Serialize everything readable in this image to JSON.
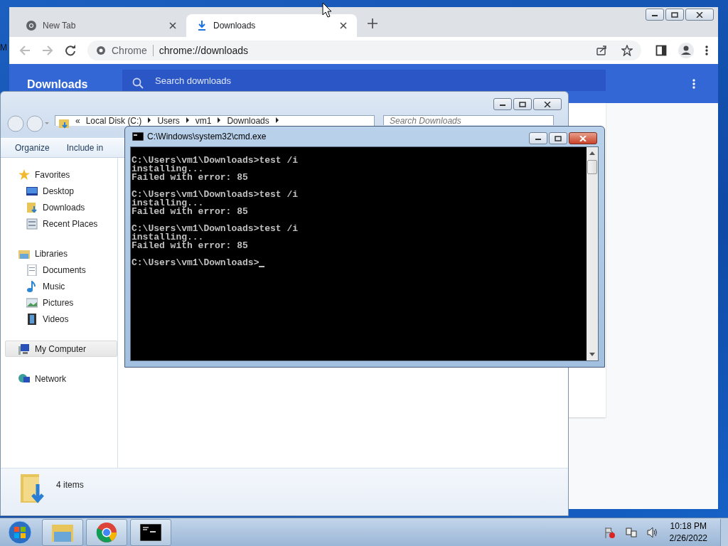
{
  "desktop": {
    "icon_label": "M"
  },
  "chrome": {
    "tabs": [
      {
        "title": "New Tab",
        "kind": "chrome",
        "selected": false
      },
      {
        "title": "Downloads",
        "kind": "download",
        "selected": true
      }
    ],
    "omnibox": {
      "site": "Chrome",
      "url": "chrome://downloads"
    },
    "page": {
      "title": "Downloads",
      "search_placeholder": "Search downloads"
    }
  },
  "explorer": {
    "overflow": "«",
    "breadcrumb": [
      "Local Disk (C:)",
      "Users",
      "vm1",
      "Downloads"
    ],
    "search_placeholder": "Search Downloads",
    "toolbar": [
      "Organize",
      "Include in"
    ],
    "nav": [
      {
        "label": "Favorites",
        "kind": "star",
        "selected": false,
        "children": [
          {
            "label": "Desktop",
            "kind": "desktop",
            "selected": false
          },
          {
            "label": "Downloads",
            "kind": "downloads",
            "selected": false
          },
          {
            "label": "Recent Places",
            "kind": "recent",
            "selected": false
          }
        ]
      },
      {
        "label": "Libraries",
        "kind": "library",
        "selected": false,
        "children": [
          {
            "label": "Documents",
            "kind": "document",
            "selected": false
          },
          {
            "label": "Music",
            "kind": "music",
            "selected": false
          },
          {
            "label": "Pictures",
            "kind": "pictures",
            "selected": false
          },
          {
            "label": "Videos",
            "kind": "videos",
            "selected": false
          }
        ]
      },
      {
        "label": "My Computer",
        "kind": "computer",
        "selected": true
      },
      {
        "label": "Network",
        "kind": "network",
        "selected": false
      }
    ],
    "status": "4 items"
  },
  "cmd": {
    "title": "C:\\Windows\\system32\\cmd.exe",
    "blocks": [
      [
        "C:\\Users\\vm1\\Downloads>test /i",
        "installing...",
        "Failed with error: 85"
      ],
      [
        "C:\\Users\\vm1\\Downloads>test /i",
        "installing...",
        "Failed with error: 85"
      ],
      [
        "C:\\Users\\vm1\\Downloads>test /i",
        "installing...",
        "Failed with error: 85"
      ],
      [
        "C:\\Users\\vm1\\Downloads>"
      ]
    ]
  },
  "taskbar": {
    "apps": [
      {
        "kind": "explorer"
      },
      {
        "kind": "chrome"
      },
      {
        "kind": "cmd"
      }
    ],
    "time": "10:18 PM",
    "date": "2/26/2022"
  }
}
